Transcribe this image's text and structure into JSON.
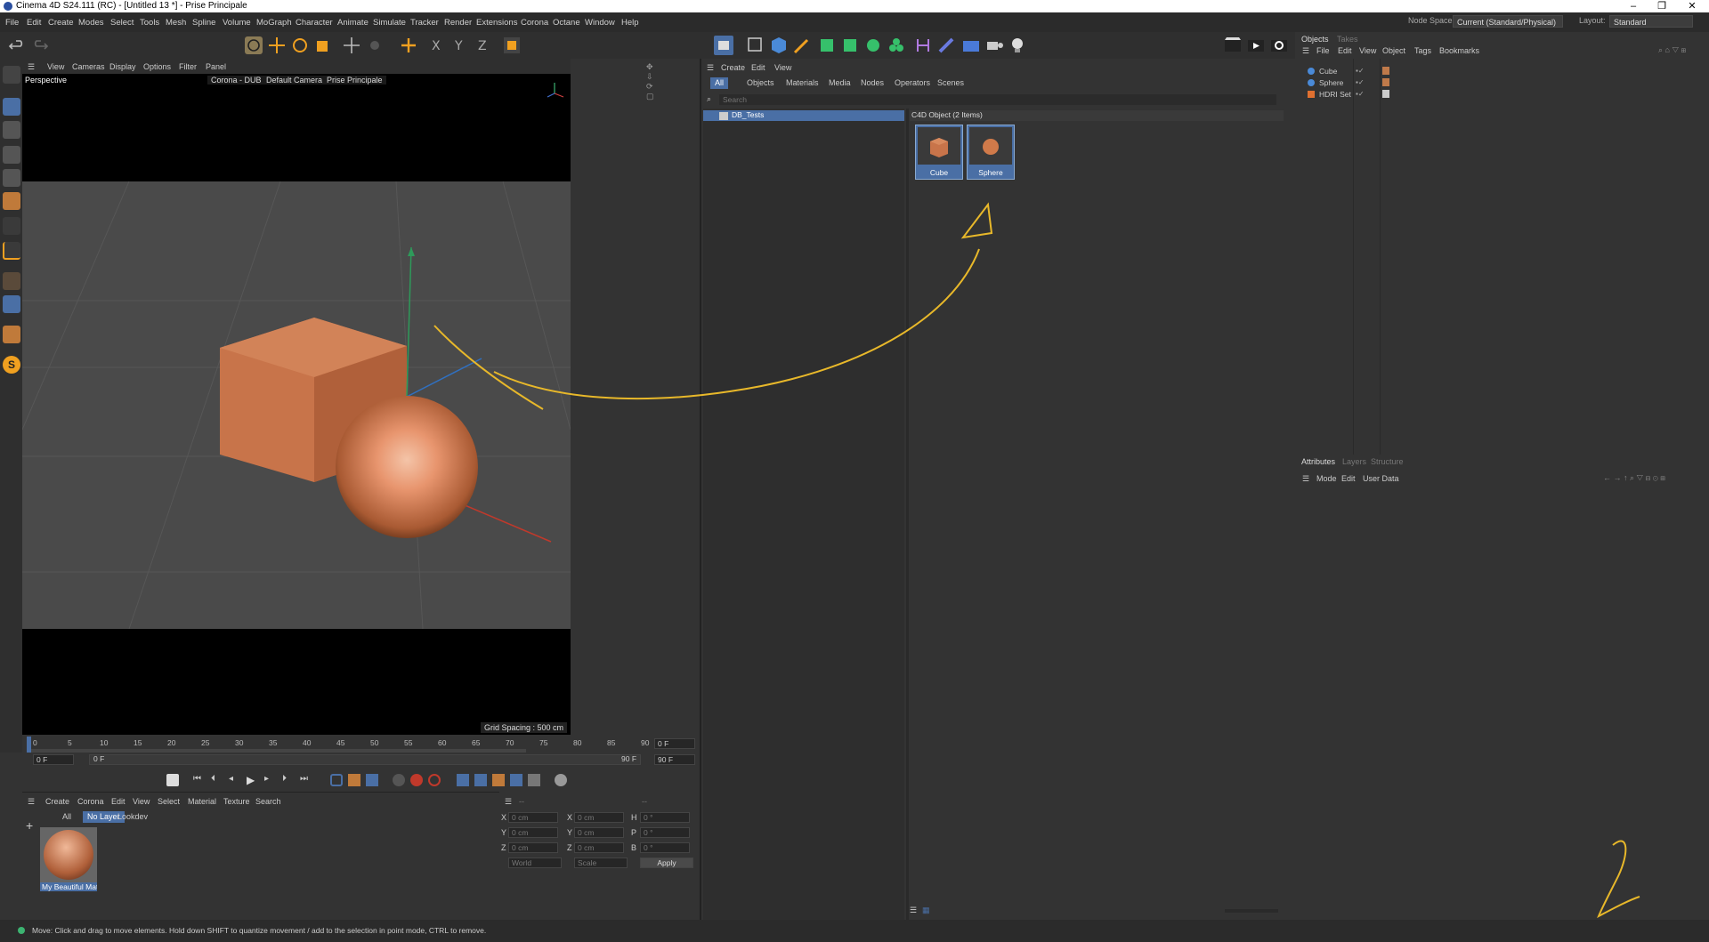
{
  "title": "Cinema 4D S24.111 (RC) - [Untitled 13 *] - Prise Principale",
  "menu": [
    "File",
    "Edit",
    "Create",
    "Modes",
    "Select",
    "Tools",
    "Mesh",
    "Spline",
    "Volume",
    "MoGraph",
    "Character",
    "Animate",
    "Simulate",
    "Tracker",
    "Render",
    "Extensions",
    "Corona",
    "Octane",
    "Window",
    "Help"
  ],
  "node_space_label": "Node Space:",
  "node_space_value": "Current (Standard/Physical)",
  "layout_label": "Layout:",
  "layout_value": "Standard",
  "viewport": {
    "menu": [
      "View",
      "Cameras",
      "Display",
      "Options",
      "Filter",
      "Panel"
    ],
    "label": "Perspective",
    "renderer": "Corona - DUB",
    "camera": "Default Camera",
    "take": "Prise Principale",
    "grid_spacing": "Grid Spacing : 500 cm",
    "axis_x": "X",
    "axis_y": "Y",
    "axis_z": "Z"
  },
  "timeline": {
    "ticks": [
      "0",
      "5",
      "10",
      "15",
      "20",
      "25",
      "30",
      "35",
      "40",
      "45",
      "50",
      "55",
      "60",
      "65",
      "70",
      "75",
      "80",
      "85",
      "90"
    ],
    "current_frame": "0 F",
    "start": "0 F",
    "range_start": "0 F",
    "range_end": "90 F",
    "end": "90 F"
  },
  "material_manager": {
    "menu": [
      "Create",
      "Corona",
      "Edit",
      "View",
      "Select",
      "Material",
      "Texture",
      "Search"
    ],
    "filters": [
      "All",
      "No Layer",
      "Lookdev"
    ],
    "material_name": "My Beautiful Mate"
  },
  "coordinates": {
    "rows": [
      {
        "a": "X",
        "av": "0 cm",
        "b": "X",
        "bv": "0 cm",
        "c": "H",
        "cv": "0 °"
      },
      {
        "a": "Y",
        "av": "0 cm",
        "b": "Y",
        "bv": "0 cm",
        "c": "P",
        "cv": "0 °"
      },
      {
        "a": "Z",
        "av": "0 cm",
        "b": "Z",
        "bv": "0 cm",
        "c": "B",
        "cv": "0 °"
      }
    ],
    "mode": "World",
    "scale": "Scale",
    "apply": "Apply",
    "dash1": "--",
    "dash2": "--"
  },
  "asset_browser": {
    "menu": [
      "Create",
      "Edit",
      "View"
    ],
    "tabs": [
      "All",
      "Objects",
      "Materials",
      "Media",
      "Nodes",
      "Operators",
      "Scenes"
    ],
    "search_placeholder": "Search",
    "folder": "DB_Tests",
    "category": "C4D Object (2 Items)",
    "items": [
      "Cube",
      "Sphere"
    ]
  },
  "objects_panel": {
    "tabs": [
      "Objects",
      "Takes"
    ],
    "menu": [
      "File",
      "Edit",
      "View",
      "Object",
      "Tags",
      "Bookmarks"
    ],
    "items": [
      "Cube",
      "Sphere",
      "HDRI Set"
    ]
  },
  "attributes_panel": {
    "tabs": [
      "Attributes",
      "Layers",
      "Structure"
    ],
    "menu": [
      "Mode",
      "Edit",
      "User Data"
    ]
  },
  "status": "Move: Click and drag to move elements. Hold down SHIFT to quantize movement / add to the selection in point mode, CTRL to remove.",
  "colors": {
    "accent": "#4a6fa5",
    "object": "#d07a4a",
    "annotation": "#e8b82a"
  }
}
